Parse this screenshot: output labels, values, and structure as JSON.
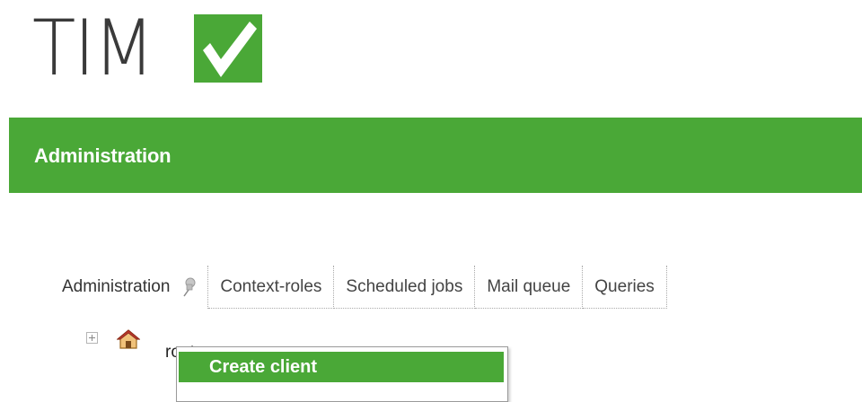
{
  "app": {
    "logo_text": "TIM",
    "logo_icon": "check-icon",
    "brand_color": "#4aa837",
    "text_color": "#3a3a3a"
  },
  "header": {
    "title": "Administration"
  },
  "tabs": [
    {
      "label": "Administration",
      "active": true,
      "icon": "pin-icon"
    },
    {
      "label": "Context-roles",
      "active": false
    },
    {
      "label": "Scheduled jobs",
      "active": false
    },
    {
      "label": "Mail queue",
      "active": false
    },
    {
      "label": "Queries",
      "active": false
    }
  ],
  "tree": {
    "root": {
      "label": "root",
      "icon": "home-icon",
      "expander_icon": "plus-icon"
    }
  },
  "context_menu": {
    "items": [
      {
        "label": "Create client",
        "highlighted": true
      }
    ]
  }
}
